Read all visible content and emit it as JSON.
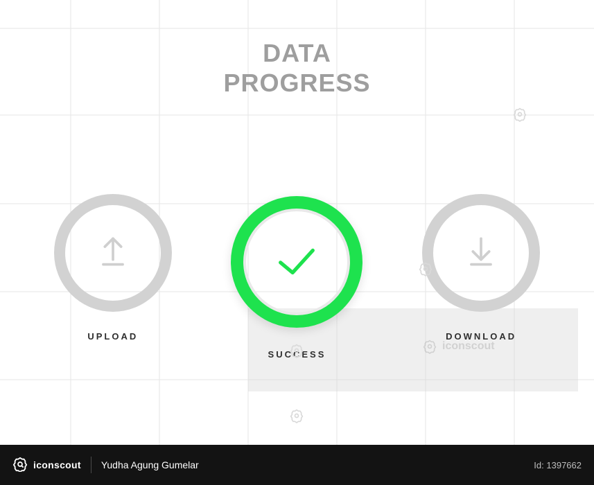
{
  "title": {
    "line1": "DATA",
    "line2": "PROGRESS"
  },
  "items": [
    {
      "label": "UPLOAD",
      "icon": "upload-icon",
      "active": false
    },
    {
      "label": "SUCCESS",
      "icon": "check-icon",
      "active": true
    },
    {
      "label": "DOWNLOAD",
      "icon": "download-icon",
      "active": false
    }
  ],
  "watermark_brand": "iconscout",
  "footer": {
    "brand": "iconscout",
    "author": "Yudha Agung Gumelar",
    "id_label": "Id:",
    "id_value": "1397662"
  },
  "colors": {
    "accent": "#1ee24e",
    "muted_ring": "#d2d2d2",
    "title_text": "#9e9e9e"
  }
}
